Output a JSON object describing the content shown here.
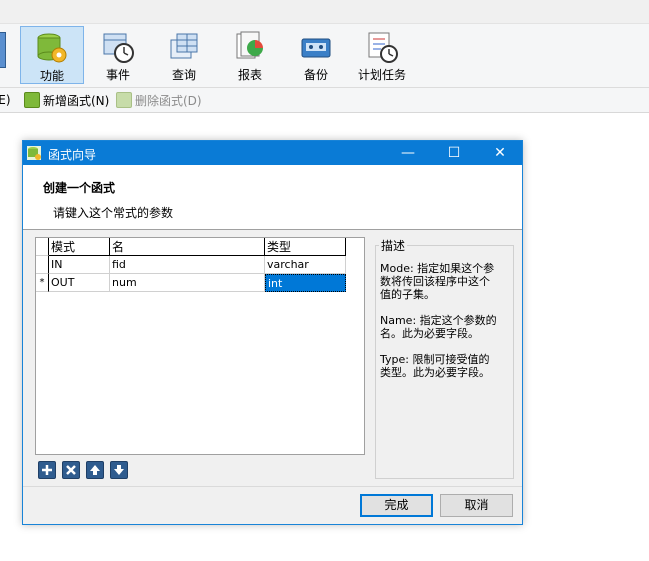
{
  "toolbar": {
    "items": [
      {
        "label": "功能",
        "icon": "function-db-icon",
        "active": true
      },
      {
        "label": "事件",
        "icon": "event-clock-icon"
      },
      {
        "label": "查询",
        "icon": "query-grid-icon"
      },
      {
        "label": "报表",
        "icon": "report-icon"
      },
      {
        "label": "备份",
        "icon": "backup-icon"
      },
      {
        "label": "计划任务",
        "icon": "schedule-task-icon"
      }
    ]
  },
  "subbar": {
    "edge_label": "E(E)",
    "new_label": "新增函式(N)",
    "delete_label": "删除函式(D)"
  },
  "dialog": {
    "title": "函式向导",
    "minimize_glyph": "—",
    "maximize_glyph": "☐",
    "close_glyph": "✕",
    "header_title": "创建一个函式",
    "header_subtitle": "请键入这个常式的参数",
    "grid": {
      "columns": [
        "模式",
        "名",
        "类型"
      ],
      "rows": [
        {
          "indicator": "",
          "mode": "IN",
          "name": "fid",
          "type": "varchar"
        },
        {
          "indicator": "*",
          "mode": "OUT",
          "name": "num",
          "type": "int"
        }
      ]
    },
    "description": {
      "legend": "描述",
      "mode_text": "Mode: 指定如果这个参数将传回该程序中这个值的子集。",
      "name_text": "Name: 指定这个参数的名。此为必要字段。",
      "type_text": "Type: 限制可接受值的类型。此为必要字段。"
    },
    "buttons": {
      "finish": "完成",
      "cancel": "取消"
    }
  },
  "colors": {
    "accent": "#0078d7",
    "titlebar": "#0a7bd6",
    "toolbar_active": "#cce4f7"
  }
}
